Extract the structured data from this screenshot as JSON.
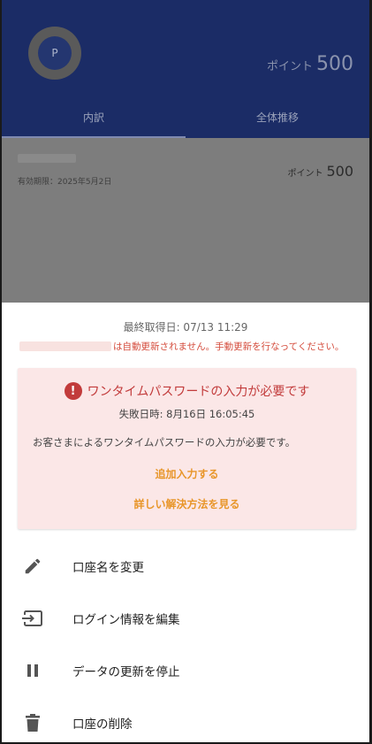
{
  "header": {
    "avatar_letter": "P",
    "points_label": "ポイント",
    "points_value": "500",
    "tabs": [
      {
        "label": "内訳"
      },
      {
        "label": "全体推移"
      }
    ]
  },
  "list": {
    "expiry": "有効期限：2025年5月2日",
    "points_label": "ポイント",
    "points_value": "500"
  },
  "sheet": {
    "last_fetch": "最終取得日: 07/13 11:29",
    "auto_update_warning": "は自動更新されません。手動更新を行なってください。",
    "alert": {
      "icon": "!",
      "title": "ワンタイムパスワードの入力が必要です",
      "fail_time": "失敗日時: 8月16日 16:05:45",
      "description": "お客さまによるワンタイムパスワードの入力が必要です。",
      "retry_label": "追加入力する",
      "detail_label": "詳しい解決方法を見る"
    },
    "menu": [
      {
        "label": "口座名を変更",
        "icon": "pencil-icon"
      },
      {
        "label": "ログイン情報を編集",
        "icon": "login-icon"
      },
      {
        "label": "データの更新を停止",
        "icon": "pause-icon"
      },
      {
        "label": "口座の削除",
        "icon": "trash-icon"
      }
    ]
  },
  "colors": {
    "header_bg": "#1b2c66",
    "alert_bg": "#fbe7e7",
    "alert_text": "#c23b3b",
    "link": "#e8962a"
  }
}
